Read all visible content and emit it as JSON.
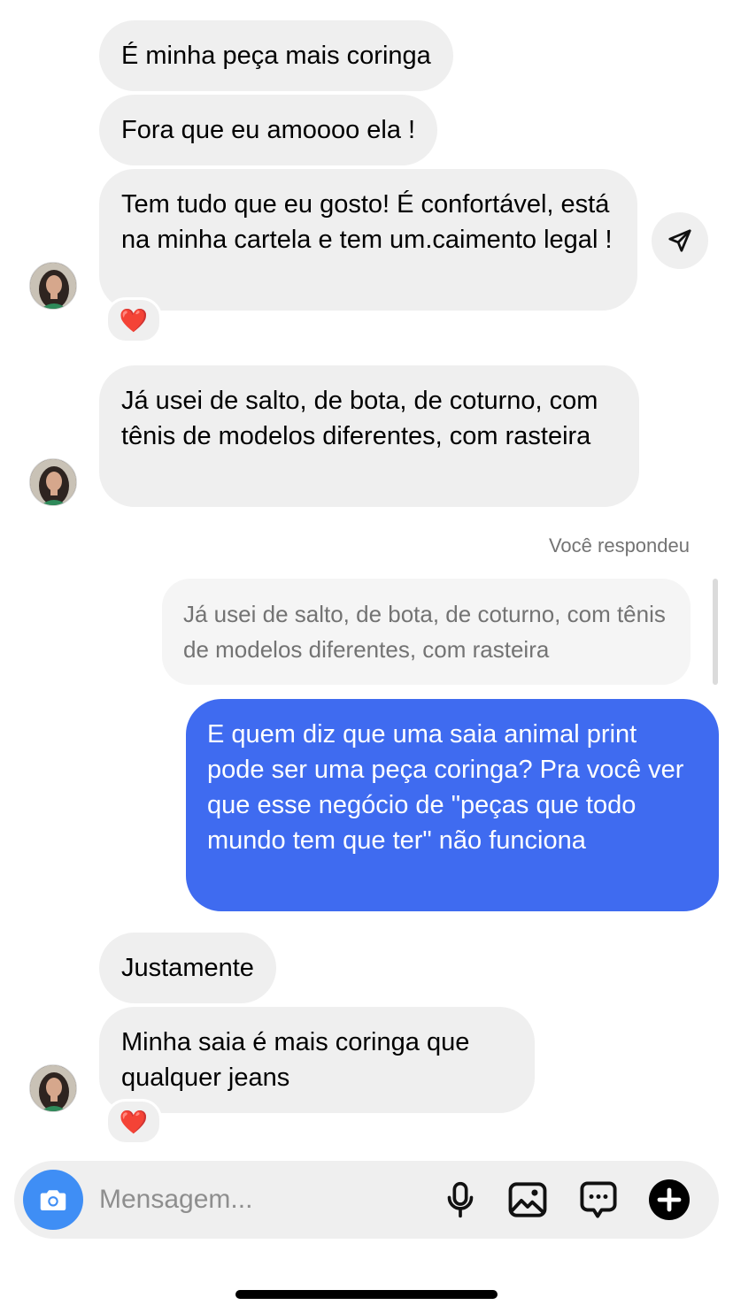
{
  "thread": {
    "messages": [
      {
        "from": "other",
        "text": "É minha peça mais coringa"
      },
      {
        "from": "other",
        "text": "Fora que eu amoooo ela !"
      },
      {
        "from": "other",
        "text": "Tem tudo que eu gosto! É confortável, está na minha cartela e tem um.caimento legal !",
        "reaction": "❤️"
      },
      {
        "from": "other",
        "text": "Já usei de salto, de bota, de coturno, com tênis de modelos diferentes, com rasteira"
      },
      {
        "from": "me",
        "status": "Você respondeu",
        "reply_to": "Já usei de salto, de bota, de coturno, com tênis de modelos diferentes, com rasteira",
        "text": "E quem diz que uma saia animal print pode ser uma peça coringa? Pra você ver que esse negócio de \"peças que todo mundo tem que ter\" não funciona"
      },
      {
        "from": "other",
        "text": "Justamente"
      },
      {
        "from": "other",
        "text": "Minha saia é mais coringa que qualquer jeans",
        "reaction": "❤️"
      }
    ]
  },
  "composer": {
    "placeholder": "Mensagem..."
  },
  "icons": {
    "camera": "camera-icon",
    "mic": "microphone-icon",
    "gallery": "image-icon",
    "sticker": "chat-sticker-icon",
    "more": "plus-icon",
    "share": "send-icon"
  },
  "colors": {
    "sent_bubble": "#3f6bf0",
    "received_bubble": "#efefef",
    "camera_button": "#3f8ef5"
  }
}
